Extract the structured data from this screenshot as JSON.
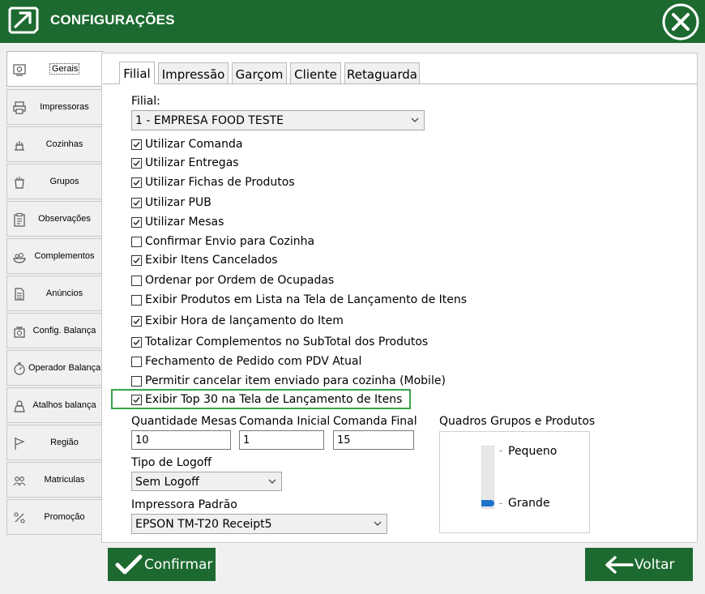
{
  "window": {
    "title": "CONFIGURAÇÕES"
  },
  "sidebar": {
    "items": [
      {
        "label": "Gerais",
        "icon": "settings-panel-icon",
        "active": true
      },
      {
        "label": "Impressoras",
        "icon": "printer-icon"
      },
      {
        "label": "Cozinhas",
        "icon": "kitchen-icon"
      },
      {
        "label": "Grupos",
        "icon": "groups-icon"
      },
      {
        "label": "Observações",
        "icon": "clipboard-icon"
      },
      {
        "label": "Complementos",
        "icon": "food-plate-icon"
      },
      {
        "label": "Anúncios",
        "icon": "document-icon"
      },
      {
        "label": "Config. Balança",
        "icon": "scale-icon"
      },
      {
        "label": "Operador Balança",
        "icon": "stopwatch-icon"
      },
      {
        "label": "Atalhos balança",
        "icon": "scale-shortcut-icon"
      },
      {
        "label": "Região",
        "icon": "flag-icon"
      },
      {
        "label": "Matriculas",
        "icon": "users-icon"
      },
      {
        "label": "Promoção",
        "icon": "promo-icon"
      }
    ]
  },
  "tabs": [
    "Filial",
    "Impressão",
    "Garçom",
    "Cliente",
    "Retaguarda"
  ],
  "filial": {
    "label": "Filial:",
    "value": "1 - EMPRESA FOOD TESTE"
  },
  "options": [
    {
      "label": "Utilizar Comanda",
      "checked": true
    },
    {
      "label": "Utilizar Entregas",
      "checked": true
    },
    {
      "label": "Utilizar Fichas de Produtos",
      "checked": true
    },
    {
      "label": "Utilizar PUB",
      "checked": true
    },
    {
      "label": "Utilizar Mesas",
      "checked": true
    },
    {
      "label": "Confirmar Envio para Cozinha",
      "checked": false
    },
    {
      "label": "Exibir Itens Cancelados",
      "checked": true
    },
    {
      "label": "Ordenar por Ordem de Ocupadas",
      "checked": false
    },
    {
      "label": "Exibir Produtos em Lista na Tela de Lançamento de Itens",
      "checked": false
    },
    {
      "label": "Exibir Hora de lançamento do Item",
      "checked": true
    },
    {
      "label": "Totalizar Complementos no SubTotal dos Produtos",
      "checked": true
    },
    {
      "label": "Fechamento de Pedido com PDV Atual",
      "checked": false
    },
    {
      "label": "Permitir cancelar item enviado para cozinha (Mobile)",
      "checked": false
    },
    {
      "label": "Exibir Top 30 na Tela de Lançamento de Itens",
      "checked": true
    }
  ],
  "fields": {
    "quantidade_mesas": {
      "label": "Quantidade Mesas",
      "value": "10"
    },
    "comanda_inicial": {
      "label": "Comanda Inicial",
      "value": "1"
    },
    "comanda_final": {
      "label": "Comanda Final",
      "value": "15"
    }
  },
  "logoff": {
    "label": "Tipo de Logoff",
    "value": "Sem Logoff"
  },
  "impressora": {
    "label": "Impressora Padrão",
    "value": "EPSON TM-T20 Receipt5"
  },
  "quadros": {
    "label": "Quadros Grupos e Produtos",
    "small": "Pequeno",
    "large": "Grande",
    "level": "Grande"
  },
  "buttons": {
    "confirm": "Confirmar",
    "back": "Voltar"
  },
  "colors": {
    "brand": "#1d6a31",
    "highlight": "#3aa54a",
    "slider": "#1e73c9"
  }
}
